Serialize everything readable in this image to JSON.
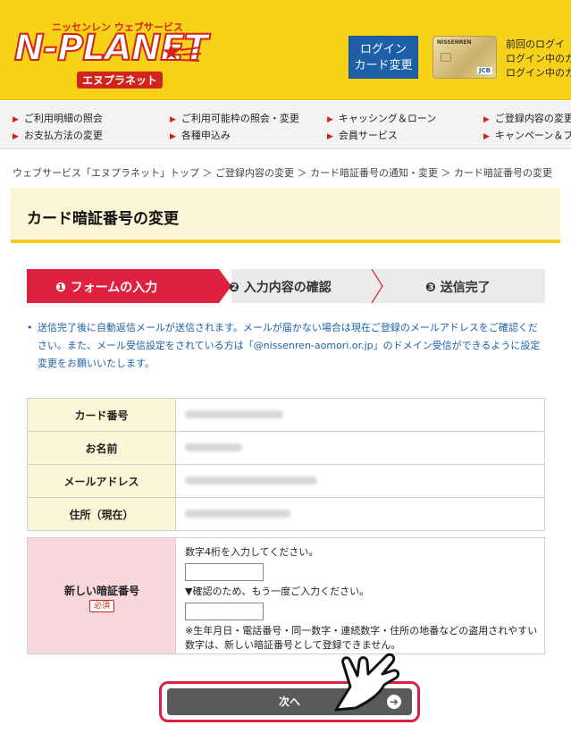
{
  "header": {
    "logo_sub": "ニッセンレン ウェブサービス",
    "logo_main": "N-PLANET",
    "logo_kana": "エヌプラネット",
    "login_button_line1": "ログイン",
    "login_button_line2": "カード変更",
    "card_brand": "NISSENREN",
    "card_jcb": "JCB",
    "login_info": [
      "前回のログイ",
      "ログイン中のカ",
      "ログイン中のカ"
    ]
  },
  "nav": {
    "items": [
      "ご利用明細の照会",
      "ご利用可能枠の照会・変更",
      "キャッシング＆ローン",
      "ご登録内容の変更",
      "お支払方法の変更",
      "各種申込み",
      "会員サービス",
      "キャンペーン＆プ"
    ]
  },
  "breadcrumb": "ウェブサービス「エヌプラネット」トップ ＞ ご登録内容の変更 ＞ カード暗証番号の通知・変更 ＞ カード暗証番号の変更",
  "page": {
    "title": "カード暗証番号の変更"
  },
  "steps": {
    "step1": "❶ フォームの入力",
    "step2": "❷ 入力内容の確認",
    "step3": "❸ 送信完了"
  },
  "notice": {
    "bullet": "•",
    "text": "送信完了後に自動返信メールが送信されます。メールが届かない場合は現在ご登録のメールアドレスをご確認ください。また、メール受信設定をされている方は「@nissenren-aomori.or.jp」のドメイン受信ができるように設定変更をお願いいたします。"
  },
  "info_table": {
    "rows": [
      {
        "label": "カード番号"
      },
      {
        "label": "お名前"
      },
      {
        "label": "メールアドレス"
      },
      {
        "label": "住所（現在）"
      }
    ]
  },
  "pin_form": {
    "label": "新しい暗証番号",
    "required": "必須",
    "instruction1": "数字4桁を入力してください。",
    "instruction2": "▼確認のため、もう一度ご入力ください。",
    "note": "※生年月日・電話番号・同一数字・連続数字・住所の地番などの盗用されやすい数字は、新しい暗証番号として登録できません。"
  },
  "next_button": {
    "label": "次へ",
    "icon": "arrow-right-circle-icon"
  },
  "colors": {
    "header_bg": "#f7d218",
    "accent_red": "#e0203f",
    "login_blue": "#1e60a8",
    "button_gray": "#5a5a5a"
  }
}
